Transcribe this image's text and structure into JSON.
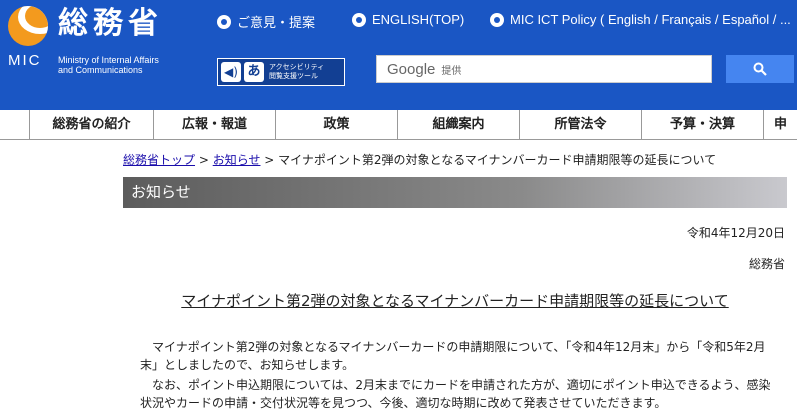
{
  "header": {
    "site_title": "総務省",
    "abbr": "MIC",
    "subtitle_line1": "Ministry of Internal Affairs",
    "subtitle_line2": "and Communications",
    "links": [
      {
        "label": "ご意見・提案"
      },
      {
        "label": "ENGLISH(TOP)"
      },
      {
        "label": "MIC ICT Policy ( English / Français / Español / ..."
      }
    ],
    "accessibility_line1": "アクセシビリティ",
    "accessibility_line2": "閲覧支援ツール",
    "search_brand": "Google",
    "search_provided": "提供",
    "accent_color": "#1a56c4",
    "search_button_color": "#4585f0"
  },
  "nav": {
    "items": [
      {
        "label": "総務省の紹介"
      },
      {
        "label": "広報・報道"
      },
      {
        "label": "政策"
      },
      {
        "label": "組織案内"
      },
      {
        "label": "所管法令"
      },
      {
        "label": "予算・決算"
      },
      {
        "label": "申"
      }
    ]
  },
  "breadcrumb": {
    "home": "総務省トップ",
    "sep": " > ",
    "news": "お知らせ",
    "current": "マイナポイント第2弾の対象となるマイナンバーカード申請期限等の延長について"
  },
  "section_title": "お知らせ",
  "notice": {
    "date": "令和4年12月20日",
    "org": "総務省",
    "title": "マイナポイント第2弾の対象となるマイナンバーカード申請期限等の延長について",
    "paragraph1": "マイナポイント第2弾の対象となるマイナンバーカードの申請期限について、「令和4年12月末」から「令和5年2月末」としましたので、お知らせします。",
    "paragraph2": "なお、ポイント申込期限については、2月末までにカードを申請された方が、適切にポイント申込できるよう、感染状況やカードの申請・交付状況等を見つつ、今後、適切な時期に改めて発表させていただきます。"
  }
}
